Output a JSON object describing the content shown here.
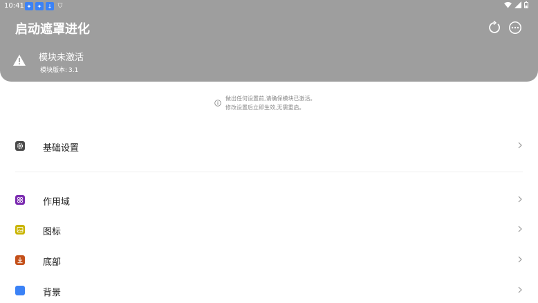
{
  "status_bar": {
    "time": "10:41"
  },
  "header": {
    "title": "启动遮罩进化",
    "module_status": "模块未激活",
    "module_version_label": "模块版本:",
    "module_version": "3.1"
  },
  "notice": {
    "line1": "做出任何设置前,请确保模块已激活。",
    "line2": "修改设置后立即生效,无需重启。"
  },
  "settings": {
    "basic": {
      "label": "基础设置",
      "icon": "gear-icon"
    },
    "scope": {
      "label": "作用域",
      "icon": "scope-icon"
    },
    "icon": {
      "label": "图标",
      "icon": "image-icon"
    },
    "bottom": {
      "label": "底部",
      "icon": "download-icon"
    },
    "background": {
      "label": "背景",
      "icon": "background-icon"
    }
  },
  "colors": {
    "header_bg": "#9e9e9e",
    "scope_icon": "#7b2bb0",
    "icon_icon": "#c9b400",
    "bottom_icon": "#c4501a",
    "background_icon": "#3b82f6"
  }
}
